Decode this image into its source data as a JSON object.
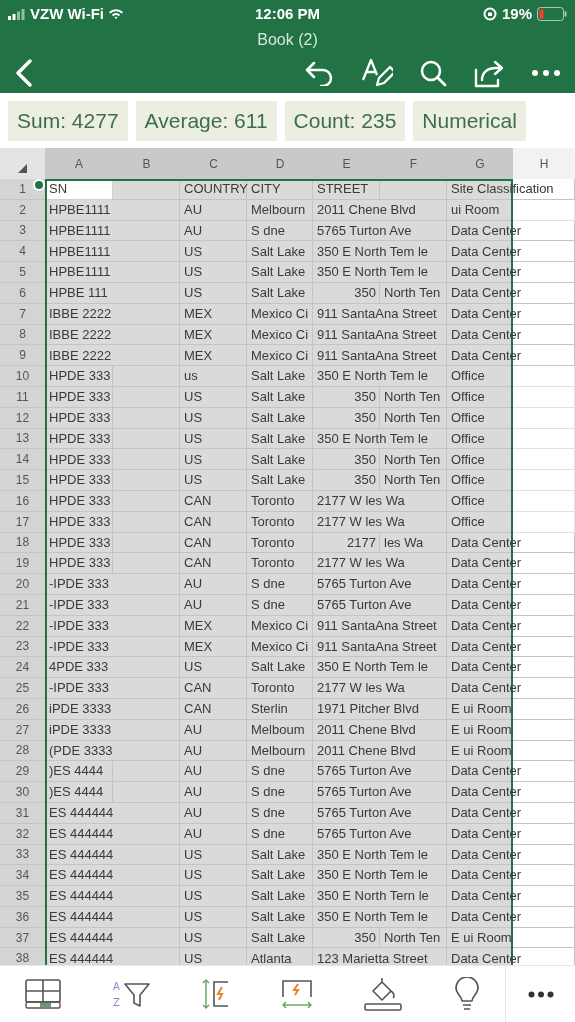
{
  "status_bar": {
    "carrier": "VZW Wi-Fi",
    "time": "12:06 PM",
    "battery": "19%"
  },
  "title": "Book (2)",
  "summary": [
    "Sum: 4277",
    "Average: 611",
    "Count: 235",
    "Numerical"
  ],
  "bottom_toolbar": {
    "sort_icon_letters": [
      "A",
      "Z"
    ]
  },
  "sheet": {
    "columns": [
      {
        "label": "A",
        "selected": true
      },
      {
        "label": "B",
        "selected": true
      },
      {
        "label": "C",
        "selected": true
      },
      {
        "label": "D",
        "selected": true
      },
      {
        "label": "E",
        "selected": true
      },
      {
        "label": "F",
        "selected": true
      },
      {
        "label": "G",
        "selected": true
      },
      {
        "label": "H",
        "selected": false
      }
    ],
    "rows": [
      {
        "row": "1",
        "cursor": true,
        "A": "SN",
        "C": "COUNTRY",
        "D": "CITY",
        "E": "STREET",
        "G": "Site Classification"
      },
      {
        "row": "2",
        "A": "HPBE1111",
        "C": "AU",
        "D": "Melbourn",
        "E": "2011 Chene Blvd",
        "G": "ui Room"
      },
      {
        "row": "3",
        "A": "HPBE1111",
        "C": "AU",
        "D": "S dne",
        "E": "5765 Turton Ave",
        "G": "Data Center"
      },
      {
        "row": "4",
        "A": "HPBE1111",
        "C": "US",
        "D": "Salt Lake",
        "E": "350 E North Tem le",
        "G": "Data Center"
      },
      {
        "row": "5",
        "A": "HPBE1111",
        "C": "US",
        "D": "Salt Lake",
        "E": "350 E North Tem le",
        "G": "Data Center"
      },
      {
        "row": "6",
        "A": "HPBE 111",
        "C": "US",
        "D": "Salt Lake",
        "E": "350",
        "F": "North Ten",
        "G": "Data Center"
      },
      {
        "row": "7",
        "A": "IBBE 2222",
        "C": "MEX",
        "D": "Mexico Ci",
        "E": "911 SantaAna Street",
        "G": "Data Center"
      },
      {
        "row": "8",
        "A": "IBBE 2222",
        "C": "MEX",
        "D": "Mexico Ci",
        "E": "911 SantaAna Street",
        "G": "Data Center"
      },
      {
        "row": "9",
        "A": "IBBE 2222",
        "C": "MEX",
        "D": "Mexico Ci",
        "E": "911 SantaAna Street",
        "G": "Data Center"
      },
      {
        "row": "10",
        "A": "HPDE 333",
        "C": "us",
        "D": "Salt Lake",
        "E": "350 E North Tem le",
        "G": "Office"
      },
      {
        "row": "11",
        "A": "HPDE 333",
        "C": "US",
        "D": "Salt Lake",
        "E": "350",
        "F": "North Ten",
        "G": "Office"
      },
      {
        "row": "12",
        "A": "HPDE 333",
        "C": "US",
        "D": "Salt Lake",
        "E": "350",
        "F": "North Ten",
        "G": "Office"
      },
      {
        "row": "13",
        "A": "HPDE 333",
        "C": "US",
        "D": "Salt Lake",
        "E": "350 E North Tem le",
        "G": "Office"
      },
      {
        "row": "14",
        "A": "HPDE 333",
        "C": "US",
        "D": "Salt Lake",
        "E": "350",
        "F": "North Ten",
        "G": "Office"
      },
      {
        "row": "15",
        "A": "HPDE 333",
        "C": "US",
        "D": "Salt Lake",
        "E": "350",
        "F": "North Ten",
        "G": "Office"
      },
      {
        "row": "16",
        "A": "HPDE 333",
        "C": "CAN",
        "D": "Toronto",
        "E": "2177 W les Wa",
        "G": "Office"
      },
      {
        "row": "17",
        "A": "HPDE 333",
        "C": "CAN",
        "D": "Toronto",
        "E": "2177 W les Wa",
        "G": "Office"
      },
      {
        "row": "18",
        "A": "HPDE 333",
        "C": "CAN",
        "D": "Toronto",
        "E": "2177",
        "F": "les Wa",
        "G": "Data Center"
      },
      {
        "row": "19",
        "A": "HPDE 333",
        "C": "CAN",
        "D": "Toronto",
        "E": "2177 W les Wa",
        "G": "Data Center"
      },
      {
        "row": "20",
        "A": "-IPDE 333",
        "C": "AU",
        "D": "S dne",
        "E": "5765 Turton Ave",
        "G": "Data Center"
      },
      {
        "row": "21",
        "A": "-IPDE 333",
        "C": "AU",
        "D": "S dne",
        "E": "5765 Turton Ave",
        "G": "Data Center"
      },
      {
        "row": "22",
        "A": "-IPDE 333",
        "C": "MEX",
        "D": "Mexico Ci",
        "E": "911 SantaAna Street",
        "G": "Data Center"
      },
      {
        "row": "23",
        "A": "-IPDE 333",
        "C": "MEX",
        "D": "Mexico Ci",
        "E": "911 SantaAna Street",
        "G": "Data Center"
      },
      {
        "row": "24",
        "A": "4PDE 333",
        "C": "US",
        "D": "Salt Lake",
        "E": "350 E North Tem le",
        "G": "Data Center"
      },
      {
        "row": "25",
        "A": "-IPDE 333",
        "C": "CAN",
        "D": "Toronto",
        "E": "2177 W les Wa",
        "G": "Data Center"
      },
      {
        "row": "26",
        "A": "iPDE 3333",
        "C": "CAN",
        "D": "Sterlin",
        "E": "1971 Pitcher Blvd",
        "G": "E ui Room"
      },
      {
        "row": "27",
        "A": "iPDE 3333",
        "C": "AU",
        "D": "Melboum",
        "E": "2011 Chene Blvd",
        "G": "E ui Room"
      },
      {
        "row": "28",
        "A": "(PDE 3333",
        "C": "AU",
        "D": "Melbourn",
        "E": "2011 Chene Blvd",
        "G": "E ui Room"
      },
      {
        "row": "29",
        "A": ")ES 4444",
        "C": "AU",
        "D": "S dne",
        "E": "5765 Turton Ave",
        "G": "Data Center"
      },
      {
        "row": "30",
        "A": ")ES 4444",
        "C": "AU",
        "D": "S dne",
        "E": "5765 Turton Ave",
        "G": "Data Center"
      },
      {
        "row": "31",
        "A": "ES 444444",
        "C": "AU",
        "D": "S dne",
        "E": "5765 Turton Ave",
        "G": "Data Center"
      },
      {
        "row": "32",
        "A": "ES 444444",
        "C": "AU",
        "D": "S dne",
        "E": "5765 Turton Ave",
        "G": "Data Center"
      },
      {
        "row": "33",
        "A": "ES 444444",
        "C": "US",
        "D": "Salt Lake",
        "E": "350 E North Tem le",
        "G": "Data Center"
      },
      {
        "row": "34",
        "A": "ES 444444",
        "C": "US",
        "D": "Salt Lake",
        "E": "350 E North Tem le",
        "G": "Data Center"
      },
      {
        "row": "35",
        "A": "ES 444444",
        "C": "US",
        "D": "Salt Lake",
        "E": "350 E North Tern le",
        "G": "Data Center"
      },
      {
        "row": "36",
        "A": "ES 444444",
        "C": "US",
        "D": "Salt Lake",
        "E": "350 E North Tem le",
        "G": "Data Center"
      },
      {
        "row": "37",
        "A": "ES 444444",
        "C": "US",
        "D": "Salt Lake",
        "E": "350",
        "F": "North Ten",
        "G": "E ui Room"
      },
      {
        "row": "38",
        "A": "ES 444444",
        "C": "US",
        "D": "Atlanta",
        "E": "123 Marietta Street",
        "G": "Data Center"
      }
    ]
  }
}
